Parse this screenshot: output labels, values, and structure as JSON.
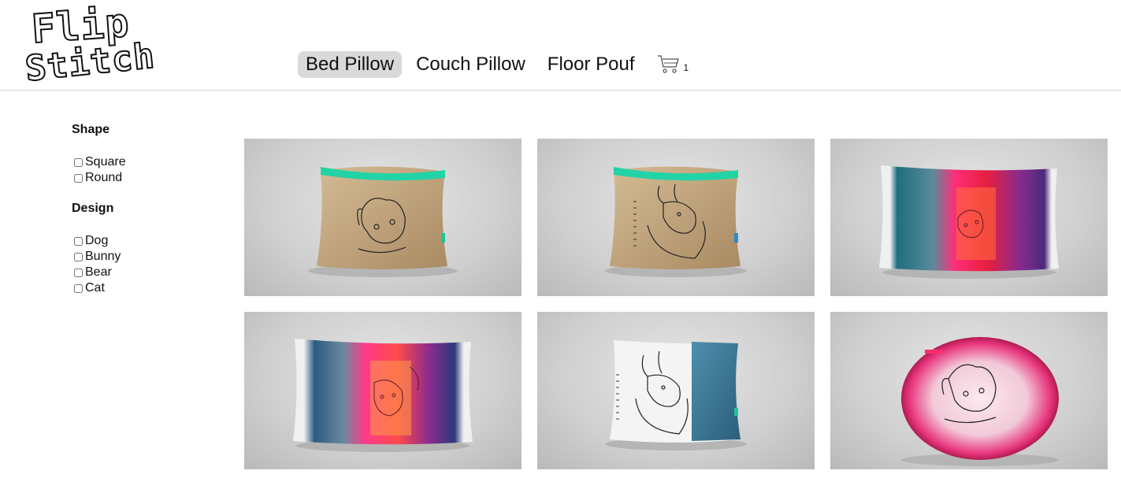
{
  "logo": {
    "line1": "Flip",
    "line2": "Stitch"
  },
  "nav": {
    "items": [
      {
        "label": "Bed Pillow",
        "active": true
      },
      {
        "label": "Couch Pillow",
        "active": false
      },
      {
        "label": "Floor Pouf",
        "active": false
      }
    ],
    "cart_icon": "shopping-cart-icon",
    "cart_count": "1"
  },
  "filters": {
    "shape": {
      "heading": "Shape",
      "options": [
        "Square",
        "Round"
      ]
    },
    "design": {
      "heading": "Design",
      "options": [
        "Dog",
        "Bunny",
        "Bear",
        "Cat"
      ]
    }
  },
  "products": [
    {
      "image": "bed-pillow-burlap-dog",
      "colors": [
        "#c7ab85",
        "#1fd6a8"
      ]
    },
    {
      "image": "bed-pillow-burlap-bunny",
      "colors": [
        "#c7ab85",
        "#1fd6a8"
      ]
    },
    {
      "image": "bed-pillow-neon-dog",
      "colors": [
        "#2a8a9a",
        "#ff2e80",
        "#5a2c8a"
      ]
    },
    {
      "image": "bed-pillow-neon-bear",
      "colors": [
        "#2a8a9a",
        "#ff2e80",
        "#5a2c8a"
      ]
    },
    {
      "image": "bed-pillow-white-bunny-blue",
      "colors": [
        "#f5f5f5",
        "#3d7fa0"
      ]
    },
    {
      "image": "round-pouf-pink-dog",
      "colors": [
        "#f5d6e4",
        "#e0357d"
      ]
    }
  ]
}
